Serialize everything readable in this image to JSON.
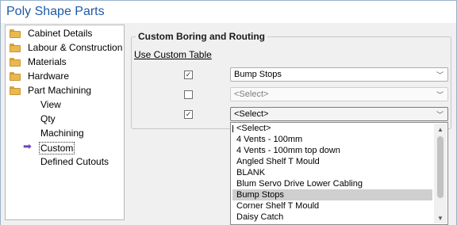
{
  "window": {
    "title": "Poly Shape Parts"
  },
  "tree": {
    "items": [
      {
        "label": "Cabinet Details",
        "type": "folder"
      },
      {
        "label": "Labour & Construction",
        "type": "folder"
      },
      {
        "label": "Materials",
        "type": "folder"
      },
      {
        "label": "Hardware",
        "type": "folder"
      },
      {
        "label": "Part Machining",
        "type": "folder-open"
      },
      {
        "label": "View",
        "type": "child"
      },
      {
        "label": "Qty",
        "type": "child"
      },
      {
        "label": "Machining",
        "type": "child"
      },
      {
        "label": "Custom",
        "type": "child-selected"
      },
      {
        "label": "Defined Cutouts",
        "type": "child"
      }
    ]
  },
  "group": {
    "title": "Custom Boring and Routing",
    "use_custom_table": "Use Custom Table",
    "rows": [
      {
        "checked": true,
        "value": "Bump Stops",
        "enabled": true
      },
      {
        "checked": false,
        "value": "<Select>",
        "enabled": false
      },
      {
        "checked": true,
        "value": "<Select>",
        "enabled": true,
        "open": true
      }
    ]
  },
  "dropdown": {
    "items": [
      "<Select>",
      "4 Vents - 100mm",
      "4 Vents - 100mm top down",
      "Angled Shelf T Mould",
      "BLANK",
      "Blum Servo Drive Lower Cabling",
      "Bump Stops",
      "Corner Shelf T Mould",
      "Daisy Catch"
    ],
    "highlighted": "Bump Stops"
  },
  "icons": {
    "check": "✓",
    "chevron_down": "﹀",
    "selection_arrow": "➡",
    "scroll_up": "▲",
    "scroll_down": "▼"
  },
  "colors": {
    "title": "#1e5aa8",
    "folder": "#e8b94e",
    "selection_arrow": "#6a49b8",
    "highlight": "#cfcfcf"
  }
}
